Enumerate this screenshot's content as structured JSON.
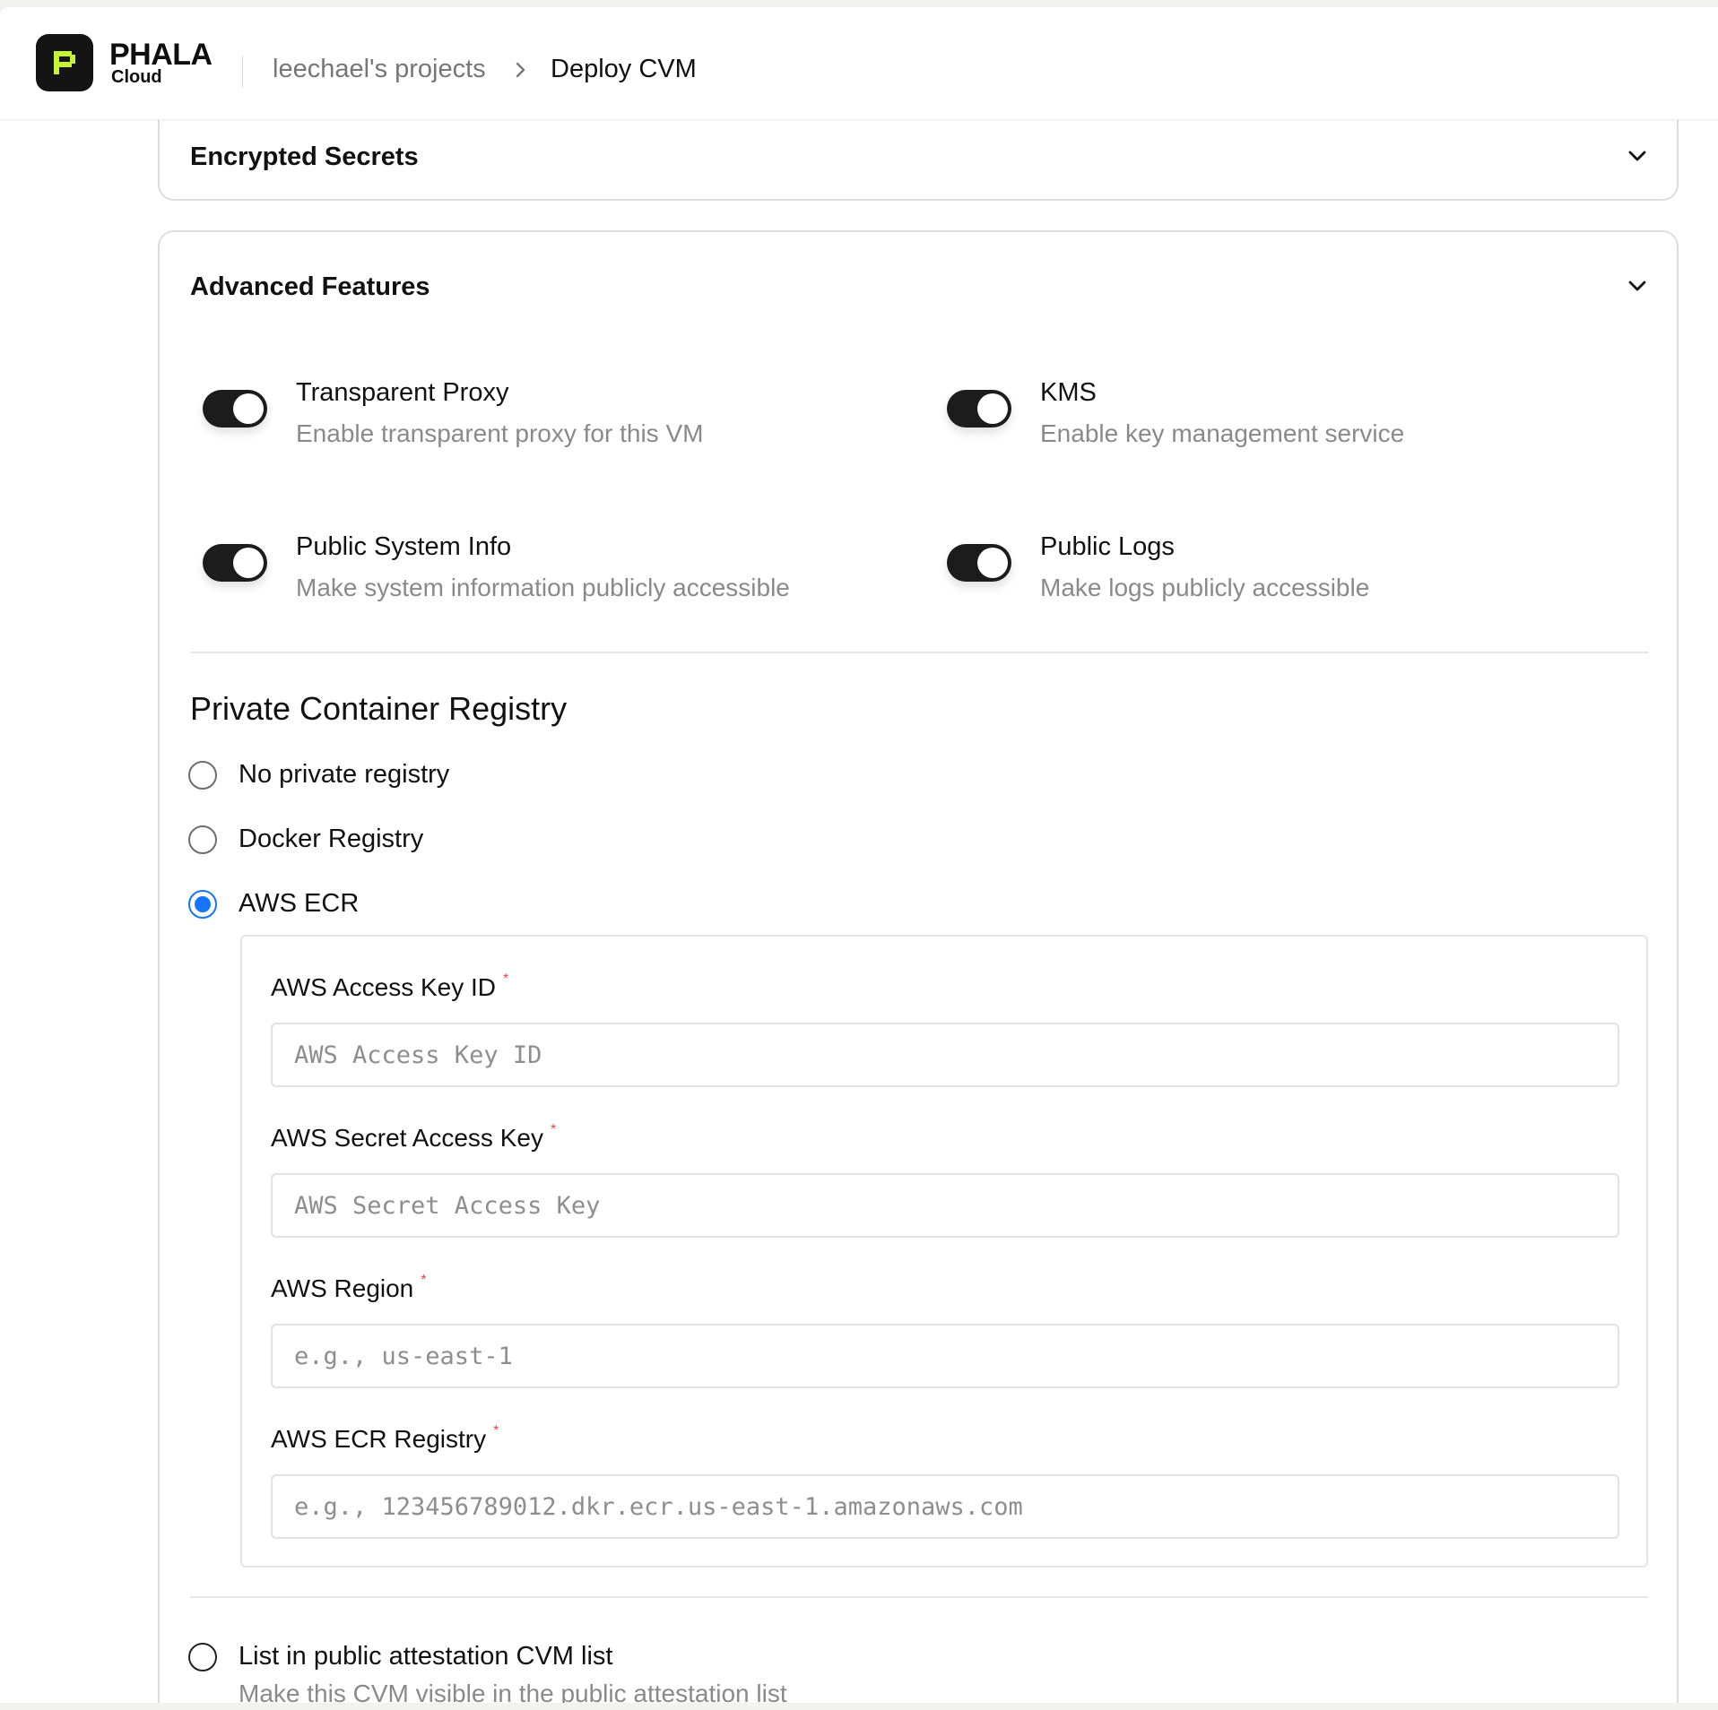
{
  "header": {
    "brand_name": "PHALA",
    "brand_sub": "Cloud",
    "breadcrumb_project": "leechael's projects",
    "breadcrumb_current": "Deploy CVM"
  },
  "encrypted_secrets": {
    "title": "Encrypted Secrets"
  },
  "advanced_features": {
    "title": "Advanced Features",
    "toggles": [
      {
        "label": "Transparent Proxy",
        "description": "Enable transparent proxy for this VM",
        "on": true
      },
      {
        "label": "KMS",
        "description": "Enable key management service",
        "on": true
      },
      {
        "label": "Public System Info",
        "description": "Make system information publicly accessible",
        "on": true
      },
      {
        "label": "Public Logs",
        "description": "Make logs publicly accessible",
        "on": true
      }
    ],
    "registry": {
      "title": "Private Container Registry",
      "options": [
        {
          "label": "No private registry",
          "selected": false
        },
        {
          "label": "Docker Registry",
          "selected": false
        },
        {
          "label": "AWS ECR",
          "selected": true
        }
      ],
      "aws_ecr": {
        "fields": [
          {
            "label": "AWS Access Key ID",
            "required": "*",
            "placeholder": "AWS Access Key ID",
            "value": ""
          },
          {
            "label": "AWS Secret Access Key",
            "required": "*",
            "placeholder": "AWS Secret Access Key",
            "value": ""
          },
          {
            "label": "AWS Region",
            "required": "*",
            "placeholder": "e.g., us-east-1",
            "value": ""
          },
          {
            "label": "AWS ECR Registry",
            "required": "*",
            "placeholder": "e.g., 123456789012.dkr.ecr.us-east-1.amazonaws.com",
            "value": ""
          }
        ]
      }
    },
    "public_attestation": {
      "label": "List in public attestation CVM list",
      "description": "Make this CVM visible in the public attestation list",
      "selected": false
    }
  },
  "colors": {
    "accent": "#1674ff",
    "brand_green": "#c6f432",
    "toggle_on": "#1c1c1c",
    "required": "#e5484d"
  },
  "icons": {
    "logo": "phala-logo-icon",
    "breadcrumb_separator": "chevron-right-icon",
    "collapse": "chevron-down-icon"
  }
}
